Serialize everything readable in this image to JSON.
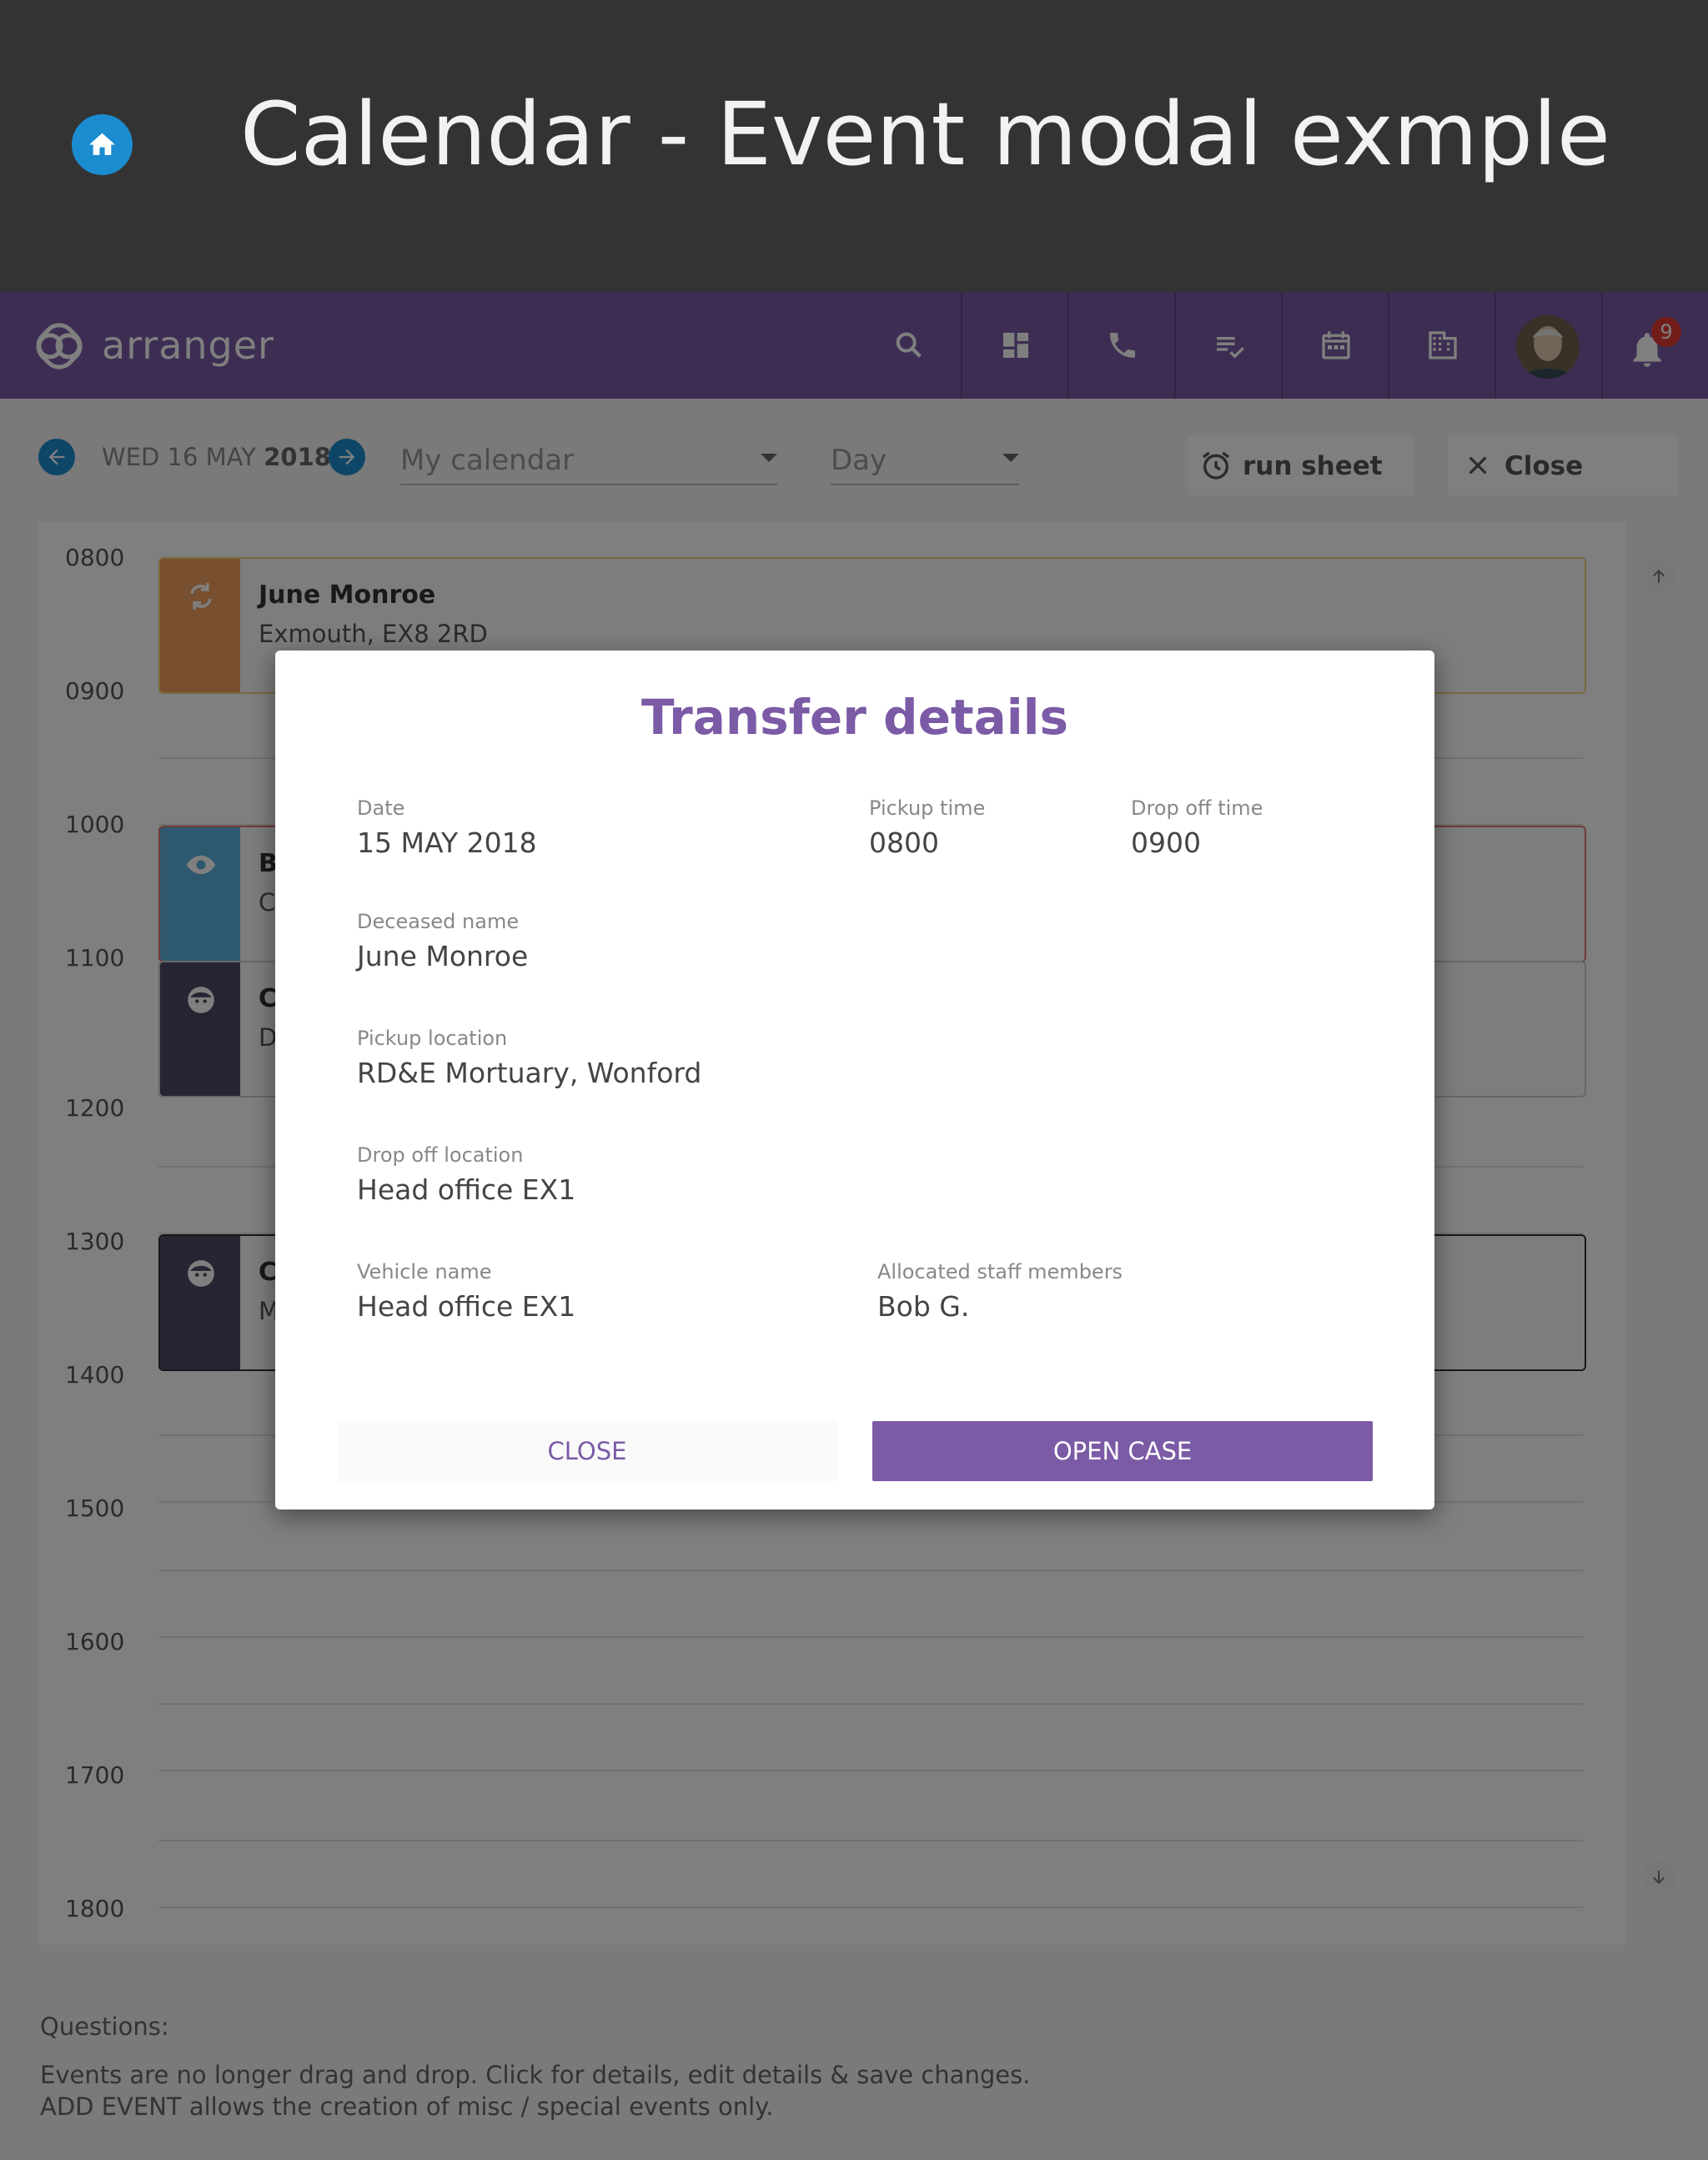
{
  "doc": {
    "title": "Calendar - Event modal exmple",
    "home_icon": "home-icon"
  },
  "appbar": {
    "brand": "arranger",
    "notification_count": "9",
    "icons": [
      "search-icon",
      "dashboard-icon",
      "phone-icon",
      "tasks-icon",
      "calendar-icon",
      "building-icon",
      "avatar",
      "bell-icon"
    ],
    "color": "#7b5aa6"
  },
  "toolbar": {
    "date_prefix": "WED 16 MAY",
    "date_year": "2018",
    "calendar_select": "My calendar",
    "view_select": "Day",
    "run_sheet_label": "run sheet",
    "close_label": "Close"
  },
  "calendar": {
    "hours": [
      "0800",
      "0900",
      "1000",
      "1100",
      "1200",
      "1300",
      "1400",
      "1500",
      "1600",
      "1700",
      "1800"
    ],
    "events": [
      {
        "title": "June Monroe",
        "subtitle": "Exmouth, EX8 2RD",
        "icon": "transfer-icon",
        "color": "#f0a060"
      },
      {
        "title": "B",
        "subtitle": "Cl",
        "icon": "eye-icon",
        "color": "#5bb0dc"
      },
      {
        "title": "C",
        "subtitle": "D",
        "icon": "face-icon",
        "color": "#4a4a66"
      },
      {
        "title": "C",
        "subtitle": "M",
        "icon": "face-icon",
        "color": "#4a4a66"
      }
    ]
  },
  "notes": {
    "heading": "Questions:",
    "line1": "Events are no longer drag and drop. Click for details, edit details & save changes.",
    "line2": "ADD EVENT  allows the creation of misc / special events only."
  },
  "modal": {
    "title": "Transfer details",
    "date_label": "Date",
    "date_value": "15 MAY 2018",
    "pickup_time_label": "Pickup time",
    "pickup_time_value": "0800",
    "dropoff_time_label": "Drop off time",
    "dropoff_time_value": "0900",
    "deceased_label": "Deceased name",
    "deceased_value": "June Monroe",
    "pickup_location_label": "Pickup location",
    "pickup_location_value": "RD&E Mortuary, Wonford",
    "dropoff_location_label": "Drop off location",
    "dropoff_location_value": "Head office EX1",
    "vehicle_label": "Vehicle name",
    "vehicle_value": "Head office EX1",
    "staff_label": "Allocated staff members",
    "staff_value": "Bob G.",
    "close_button": "CLOSE",
    "open_case_button": "OPEN CASE"
  }
}
